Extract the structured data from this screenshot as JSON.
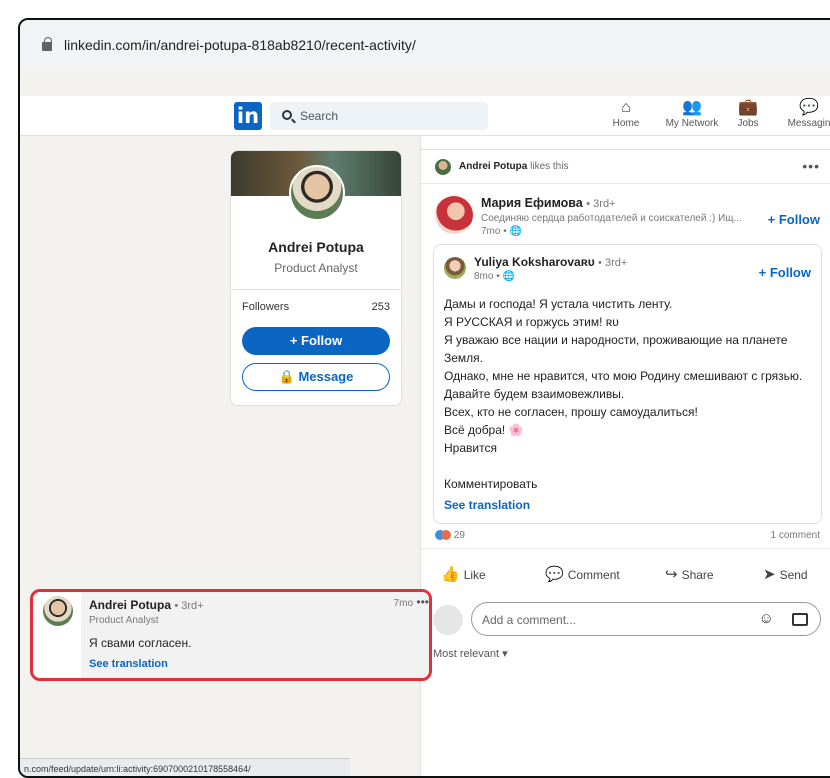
{
  "browser": {
    "url": "linkedin.com/in/andrei-potupa-818ab8210/recent-activity/"
  },
  "header": {
    "logo": "in",
    "search_placeholder": "Search",
    "nav": [
      {
        "label": "Home",
        "icon": "home-icon",
        "glyph": "⌂"
      },
      {
        "label": "My Network",
        "icon": "network-icon",
        "glyph": "👥"
      },
      {
        "label": "Jobs",
        "icon": "briefcase-icon",
        "glyph": "💼"
      },
      {
        "label": "Messagin",
        "icon": "message-icon",
        "glyph": "💬"
      }
    ]
  },
  "profile": {
    "name": "Andrei Potupa",
    "title": "Product Analyst",
    "followers_label": "Followers",
    "followers_count": "253",
    "follow_label": "+ Follow",
    "message_label": "Message"
  },
  "post": {
    "likes_actor": "Andrei Potupa",
    "likes_text": "likes this",
    "actor_name": "Мария Ефимова",
    "actor_degree": "• 3rd+",
    "actor_headline": "Соединяю сердца работодателей и соискателей :) Ищ...",
    "actor_time": "7mo •",
    "follow_label": "+ Follow",
    "shared": {
      "name": "Yuliya Koksharovaʀᴜ",
      "degree": "• 3rd+",
      "time": "8mo •",
      "follow_label": "+ Follow",
      "lines": [
        "Дамы и господа! Я устала чистить ленту.",
        "Я РУССКАЯ и горжусь этим! ʀᴜ",
        "Я уважаю все нации и народности, проживающие на планете",
        "Земля.",
        "Однако, мне не нравится, что мою Родину смешивают с грязью.",
        "Давайте будем взаимовежливы.",
        "Всех, кто не согласен, прошу самоудалиться!",
        "Всё добра! 🌸",
        "Нравится",
        "",
        "Комментировать"
      ],
      "see_translation": "See translation"
    },
    "reactions_count": "29",
    "comments_count": "1 comment",
    "actions": {
      "like": "Like",
      "comment": "Comment",
      "share": "Share",
      "send": "Send"
    },
    "comment_placeholder": "Add a comment...",
    "sort_label": "Most relevant ▾"
  },
  "comment": {
    "name": "Andrei Potupa",
    "degree": "• 3rd+",
    "headline": "Product Analyst",
    "time": "7mo",
    "text": "Я свами согласен.",
    "see_translation": "See translation"
  },
  "status_url": "n.com/feed/update/urn:li:activity:6907000210178558464/"
}
